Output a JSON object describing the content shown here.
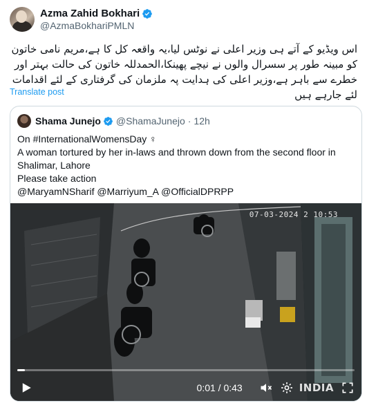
{
  "author": {
    "display_name": "Azma Zahid Bokhari",
    "handle": "@AzmaBokhariPMLN"
  },
  "post": {
    "text": "اس ویڈیو کے آتے ہی وزیر اعلی نے نوٹس لیا،یہ واقعہ کل کا ہے،مریم نامی خاتون کو مبینہ طور پر سسرال والوں نے نیچے پھینکا،الحمدللہ خاتون کی حالت بہتر اور خطرے سے باہر ہے،وزیر اعلی کی ہدایت پہ ملزمان کی گرفتاری کے لئے اقدامات لئے جارہے ہیں",
    "translate_label": "Translate post"
  },
  "quoted": {
    "display_name": "Shama Junejo",
    "handle": "@ShamaJunejo",
    "separator": "·",
    "time": "12h",
    "lines": [
      "On #InternationalWomensDay ♀",
      "A woman tortured by her in-laws and thrown down from the second floor in",
      "Shalimar, Lahore",
      "Please take action",
      "@MaryamNSharif @Marriyum_A @OfficialDPRPP"
    ]
  },
  "video": {
    "timestamp": "07-03-2024 2 10:53",
    "time_readout": "0:01 / 0:43",
    "progress": 0.023,
    "watermark": "INDIA"
  },
  "colors": {
    "accent": "#1d9bf0",
    "muted": "#536471",
    "verified": "#1d9bf0"
  },
  "icons": [
    "verified-badge-icon",
    "play-icon",
    "mute-icon",
    "settings-icon",
    "fullscreen-icon"
  ]
}
